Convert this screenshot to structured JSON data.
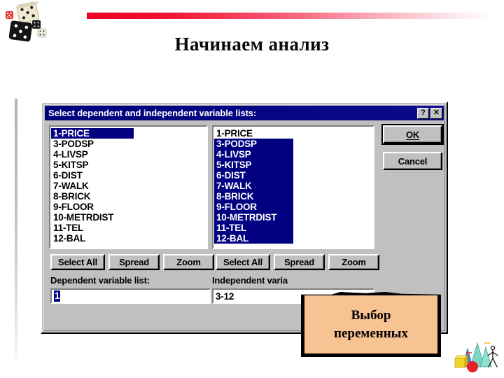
{
  "slide": {
    "title": "Начинаем анализ",
    "accent_color": "#ee0022",
    "decor_top_left": "dice-clipart",
    "decor_bottom_right": "geometry-shapes-clipart"
  },
  "dialog": {
    "titlebar": {
      "text": "Select dependent and independent variable lists:",
      "help_button": "?",
      "close_button": "✕",
      "background_color": "#000080"
    },
    "dependent_panel": {
      "items": [
        {
          "label": "1-PRICE",
          "selected": true
        },
        {
          "label": "3-PODSP",
          "selected": false
        },
        {
          "label": "4-LIVSP",
          "selected": false
        },
        {
          "label": "5-KITSP",
          "selected": false
        },
        {
          "label": "6-DIST",
          "selected": false
        },
        {
          "label": "7-WALK",
          "selected": false
        },
        {
          "label": "8-BRICK",
          "selected": false
        },
        {
          "label": "9-FLOOR",
          "selected": false
        },
        {
          "label": "10-METRDIST",
          "selected": false
        },
        {
          "label": "11-TEL",
          "selected": false
        },
        {
          "label": "12-BAL",
          "selected": false
        }
      ],
      "select_all_label": "Select All",
      "spread_label": "Spread",
      "zoom_label": "Zoom",
      "field_label": "Dependent variable list:",
      "field_value": "1"
    },
    "independent_panel": {
      "items": [
        {
          "label": "1-PRICE",
          "selected": false
        },
        {
          "label": "3-PODSP",
          "selected": true
        },
        {
          "label": "4-LIVSP",
          "selected": true
        },
        {
          "label": "5-KITSP",
          "selected": true
        },
        {
          "label": "6-DIST",
          "selected": true
        },
        {
          "label": "7-WALK",
          "selected": true
        },
        {
          "label": "8-BRICK",
          "selected": true
        },
        {
          "label": "9-FLOOR",
          "selected": true
        },
        {
          "label": "10-METRDIST",
          "selected": true
        },
        {
          "label": "11-TEL",
          "selected": true
        },
        {
          "label": "12-BAL",
          "selected": true
        }
      ],
      "select_all_label": "Select All",
      "spread_label": "Spread",
      "zoom_label": "Zoom",
      "field_label": "Independent varia",
      "field_value": "3-12"
    },
    "ok_label": "OK",
    "cancel_label": "Cancel",
    "selection_color": "#000080"
  },
  "callout": {
    "line1": "Выбор",
    "line2": "переменных",
    "fill_color": "#f8c392",
    "border_color": "#000000"
  }
}
